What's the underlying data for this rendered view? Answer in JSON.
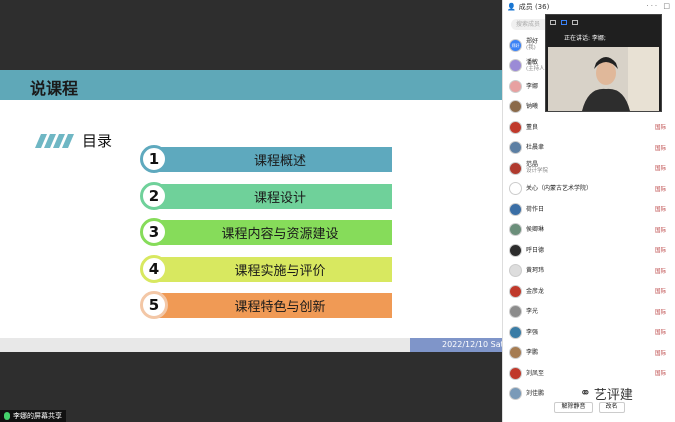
{
  "slide": {
    "title": "说课程",
    "toc_title": "目录",
    "items": [
      {
        "num": "1",
        "label": "课程概述",
        "color": "#5ea9be",
        "ring": "#5ea9be"
      },
      {
        "num": "2",
        "label": "课程设计",
        "color": "#6fd19a",
        "ring": "#6fd19a"
      },
      {
        "num": "3",
        "label": "课程内容与资源建设",
        "color": "#86dc5a",
        "ring": "#86dc5a"
      },
      {
        "num": "4",
        "label": "课程实施与评价",
        "color": "#d8e860",
        "ring": "#d8e860"
      },
      {
        "num": "5",
        "label": "课程特色与创新",
        "color": "#f09a55",
        "ring": "#f3c7a6"
      }
    ],
    "footer_date": "2022/12/10 Satu"
  },
  "screen_share": {
    "label": "李娜的屏幕共享"
  },
  "panel": {
    "header": "成员 (36)",
    "search_placeholder": "搜索成员",
    "members": [
      {
        "name": "郑好",
        "sub": "(我)",
        "avatar": "#3b82f6",
        "avatar_text": "郑好",
        "status": ""
      },
      {
        "name": "潘敏",
        "sub": "(主持人)",
        "avatar": "#9b8bd6",
        "avatar_text": "",
        "status": ""
      },
      {
        "name": "李娜",
        "sub": "",
        "avatar": "#e7a1a1",
        "avatar_text": "",
        "status": ""
      },
      {
        "name": "钠曦",
        "sub": "",
        "avatar": "#8a6a4a",
        "avatar_text": "",
        "status": ""
      },
      {
        "name": "董良",
        "sub": "",
        "avatar": "#c0392b",
        "avatar_text": "",
        "status": "国际"
      },
      {
        "name": "杜晨聿",
        "sub": "",
        "avatar": "#5c7fa3",
        "avatar_text": "",
        "status": "国际"
      },
      {
        "name": "范晶",
        "sub": "设计学院",
        "avatar": "#b03a2e",
        "avatar_text": "",
        "status": "国际"
      },
      {
        "name": "关心（内蒙古艺术学院）",
        "sub": "",
        "avatar": "#ffffff",
        "avatar_text": "",
        "status": "国际"
      },
      {
        "name": "荷作日",
        "sub": "",
        "avatar": "#3a6ea5",
        "avatar_text": "",
        "status": "国际"
      },
      {
        "name": "侯卿琳",
        "sub": "",
        "avatar": "#6b8e7a",
        "avatar_text": "",
        "status": "国际"
      },
      {
        "name": "呼日德",
        "sub": "",
        "avatar": "#2c2c2c",
        "avatar_text": "",
        "status": "国际"
      },
      {
        "name": "黄珂玮",
        "sub": "",
        "avatar": "#dddddd",
        "avatar_text": "",
        "status": "国际"
      },
      {
        "name": "金彦龙",
        "sub": "",
        "avatar": "#c0392b",
        "avatar_text": "",
        "status": "国际"
      },
      {
        "name": "李光",
        "sub": "",
        "avatar": "#8c8c8c",
        "avatar_text": "",
        "status": "国际"
      },
      {
        "name": "李强",
        "sub": "",
        "avatar": "#3a7ca5",
        "avatar_text": "",
        "status": "国际"
      },
      {
        "name": "李鹏",
        "sub": "",
        "avatar": "#a67c52",
        "avatar_text": "",
        "status": "国际"
      },
      {
        "name": "刘凤至",
        "sub": "",
        "avatar": "#c0392b",
        "avatar_text": "",
        "status": "国际"
      },
      {
        "name": "刘佳鹏",
        "sub": "",
        "avatar": "#7a9ab8",
        "avatar_text": "",
        "status": ""
      }
    ],
    "mute_all": "解除静音",
    "rename": "改名"
  },
  "video": {
    "speaking_label": "正在讲话: 李娜;",
    "name": "李娜"
  },
  "watermark": "艺评建"
}
